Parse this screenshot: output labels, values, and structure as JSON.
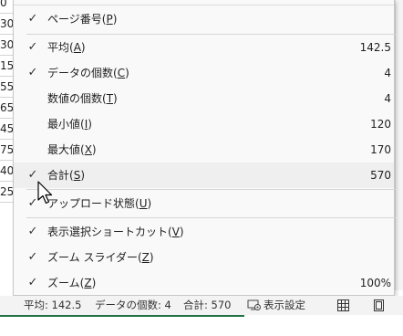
{
  "sheet": {
    "cells": [
      "0",
      "30",
      "15",
      "55",
      "65",
      "45",
      "75",
      "40",
      "25"
    ]
  },
  "menu": {
    "items": [
      {
        "label_pre": "ページ番号(",
        "acc": "P",
        "label_post": ")",
        "checked": true,
        "value": ""
      },
      {
        "label_pre": "平均(",
        "acc": "A",
        "label_post": ")",
        "checked": true,
        "value": "142.5"
      },
      {
        "label_pre": "データの個数(",
        "acc": "C",
        "label_post": ")",
        "checked": true,
        "value": "4"
      },
      {
        "label_pre": "数値の個数(",
        "acc": "T",
        "label_post": ")",
        "checked": false,
        "value": "4"
      },
      {
        "label_pre": "最小値(",
        "acc": "I",
        "label_post": ")",
        "checked": false,
        "value": "120"
      },
      {
        "label_pre": "最大値(",
        "acc": "X",
        "label_post": ")",
        "checked": false,
        "value": "170"
      },
      {
        "label_pre": "合計(",
        "acc": "S",
        "label_post": ")",
        "checked": true,
        "value": "570"
      },
      {
        "label_pre": "アップロード状態(",
        "acc": "U",
        "label_post": ")",
        "checked": true,
        "value": ""
      },
      {
        "label_pre": "表示選択ショートカット(",
        "acc": "V",
        "label_post": ")",
        "checked": true,
        "value": ""
      },
      {
        "label_pre": "ズーム スライダー(",
        "acc": "Z",
        "label_post": ")",
        "checked": true,
        "value": ""
      },
      {
        "label_pre": "ズーム(",
        "acc": "Z",
        "label_post": ")",
        "checked": true,
        "value": "100%"
      }
    ],
    "check_glyph": "✓"
  },
  "statusbar": {
    "average": "平均: 142.5",
    "count": "データの個数: 4",
    "sum": "合計: 570",
    "display_settings": "表示設定"
  },
  "colors": {
    "menu_bg": "#f9f9f9",
    "hover_bg": "#efefef",
    "excel_green": "#217346"
  }
}
